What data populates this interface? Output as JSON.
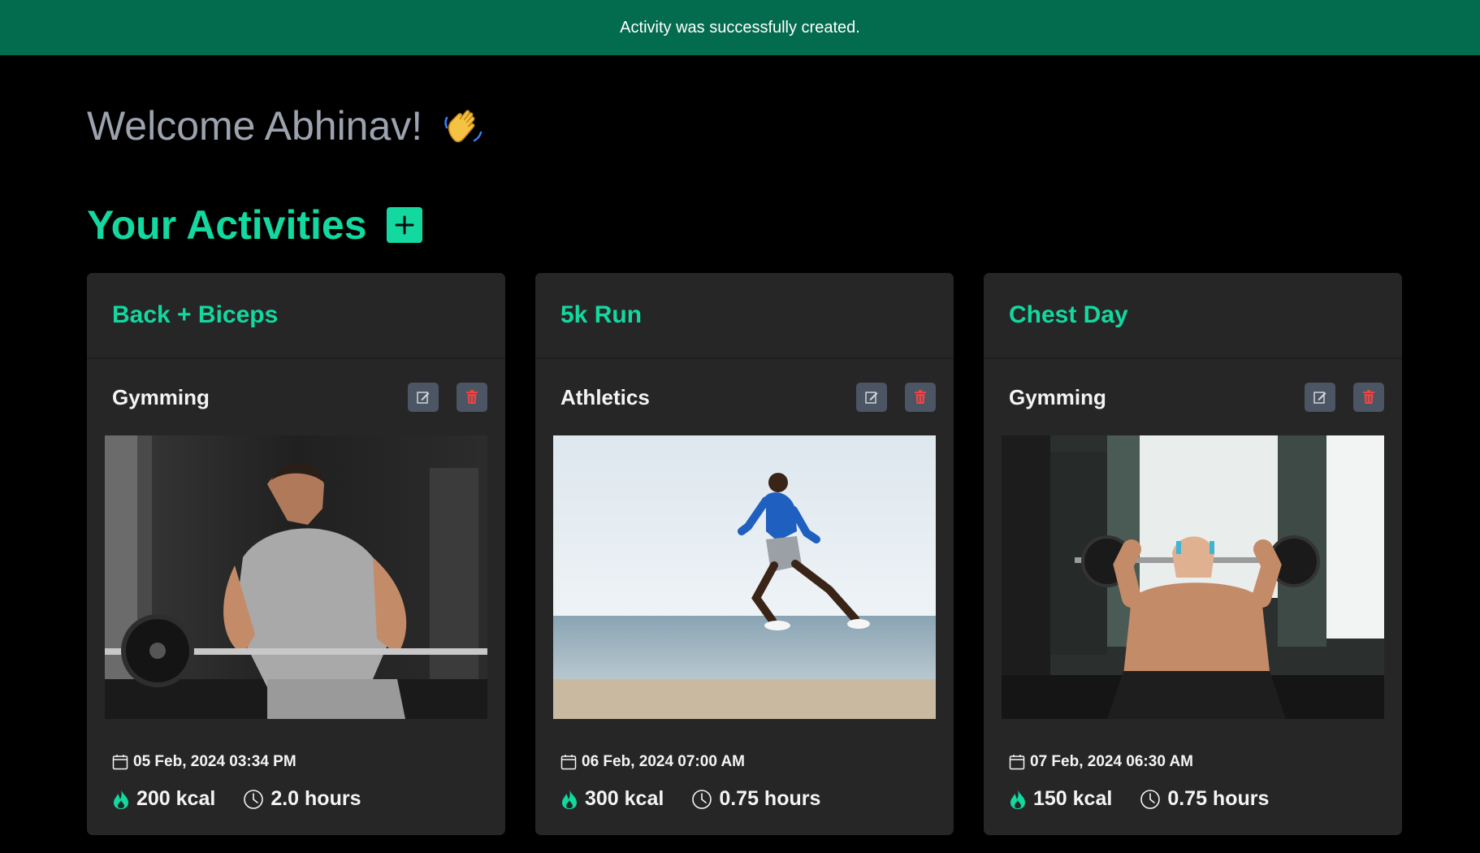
{
  "flash": {
    "message": "Activity was successfully created."
  },
  "welcome": {
    "text": "Welcome Abhinav!",
    "emoji": "👋"
  },
  "activities": {
    "heading": "Your Activities",
    "add_label": "+"
  },
  "colors": {
    "accent": "#13d8a0",
    "flash_bg": "#046c4e",
    "card_bg": "#262626",
    "delete": "#ef4444"
  },
  "cards": [
    {
      "title": "Back + Biceps",
      "category": "Gymming",
      "image": "man-barbell-row-photo",
      "date": "05 Feb, 2024 03:34 PM",
      "calories": "200 kcal",
      "duration": "2.0 hours"
    },
    {
      "title": "5k Run",
      "category": "Athletics",
      "image": "runner-on-beach-photo",
      "date": "06 Feb, 2024 07:00 AM",
      "calories": "300 kcal",
      "duration": "0.75 hours"
    },
    {
      "title": "Chest Day",
      "category": "Gymming",
      "image": "man-dumbbell-press-photo",
      "date": "07 Feb, 2024 06:30 AM",
      "calories": "150 kcal",
      "duration": "0.75 hours"
    }
  ]
}
